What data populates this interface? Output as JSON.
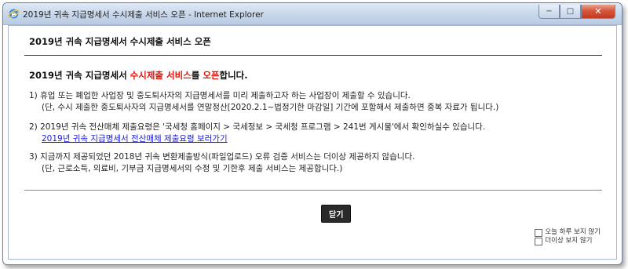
{
  "window": {
    "title": "2019년 귀속 지급명세서 수시제출 서비스 오픈 - Internet Explorer",
    "controls": {
      "minimize": "−",
      "maximize": "□",
      "close": "✕"
    }
  },
  "notice": {
    "header": "2019년 귀속 지급명세서 수시제출 서비스 오픈",
    "heading": {
      "prefix": "2019년 귀속 지급명세서 ",
      "highlight1": "수시제출 서비스",
      "middle": "를 ",
      "highlight2": "오픈",
      "suffix": "합니다."
    },
    "items": [
      {
        "line1": "1) 휴업 또는 폐업한 사업장 및 중도퇴사자의 지급명세서를 미리 제출하고자 하는 사업장이 제출할 수 있습니다.",
        "line2": "(단, 수시 제출한 중도퇴사자의 지급명세서를 연말정산[2020.2.1~법정기한 마감일] 기간에 포함해서 제출하면 중복 자료가 됩니다.)"
      },
      {
        "line1": "2) 2019년 귀속 전산매체 제출요령은 '국세청 홈페이지 > 국세정보 > 국세청 프로그램 > 241번 게시물'에서 확인하실수 있습니다.",
        "link": "2019년 귀속 지급명세서 전산매체 제출요령 보러가기"
      },
      {
        "line1": "3) 지금까지 제공되었던 2018년 귀속 변환제출방식(파일업로드) 오류 검증 서비스는 더이상 제공하지 않습니다.",
        "line2": "(단, 근로소득, 의료비, 기부금 지급명세서의 수정 및 기한후 제출 서비스는 제공합니다.)"
      }
    ],
    "close_button": "닫기",
    "options": {
      "today": "오늘 하루 보지 않기",
      "never": "더이상 보지 않기"
    }
  },
  "colors": {
    "highlight": "#e0160f",
    "link": "#1a1adb",
    "close_bg": "#2a2a2a"
  }
}
